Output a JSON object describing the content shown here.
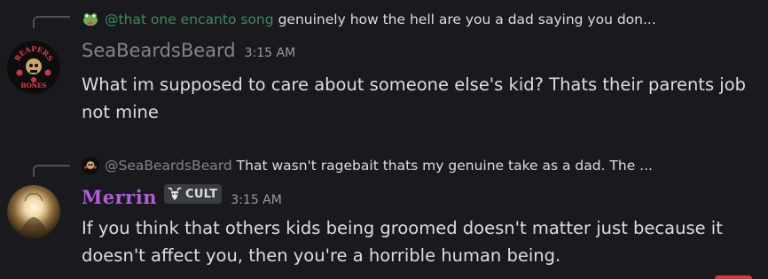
{
  "messages": [
    {
      "reply": {
        "mention": "@that one encanto song",
        "text": "genuinely how the hell are you a dad saying you don..."
      },
      "username": "SeaBeardsBeard",
      "timestamp": "3:15 AM",
      "avatar_text_top": "REAPERS",
      "avatar_text_bottom": "BONES",
      "content": "What im supposed to care about someone else's kid? Thats their parents job not mine"
    },
    {
      "reply": {
        "mention": "@SeaBeardsBeard",
        "text": "That wasn't ragebait thats my genuine take as a dad. The ..."
      },
      "username": "Merrin",
      "role": "CULT",
      "timestamp": "3:15 AM",
      "content": "If you think that others kids being groomed doesn't matter just because it doesn't affect you, then you're a horrible human being."
    }
  ],
  "colors": {
    "background": "#1a1a1e",
    "text": "#dbdee1",
    "muted": "#80848e",
    "mention_green": "#3a8a60",
    "merrin_purple": "#b05fd8",
    "badge_bg": "#3a3c43"
  }
}
